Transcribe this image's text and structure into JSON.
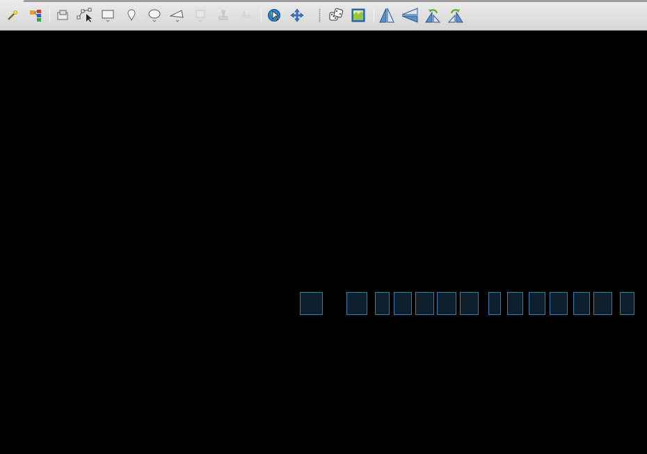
{
  "toolbar": {
    "buttons": [
      {
        "name": "magic-wand-tool-button",
        "icon": "magic-wand-icon",
        "enabled": true
      },
      {
        "name": "layers-tool-button",
        "icon": "color-layers-icon",
        "enabled": true
      },
      {
        "name": "select-region-button",
        "icon": "select-region-icon",
        "enabled": true
      },
      {
        "name": "draw-path-button",
        "icon": "path-arrow-icon",
        "enabled": true
      },
      {
        "name": "draw-rectangle-button",
        "icon": "rectangle-icon",
        "enabled": true
      },
      {
        "name": "draw-marker-button",
        "icon": "marker-pin-icon",
        "enabled": true
      },
      {
        "name": "draw-ellipse-button",
        "icon": "ellipse-icon",
        "enabled": true
      },
      {
        "name": "draw-polygon-button",
        "icon": "polygon-icon",
        "enabled": true
      },
      {
        "name": "image-tool-button",
        "icon": "image-icon",
        "enabled": false
      },
      {
        "name": "stamp-tool-button",
        "icon": "stamp-icon",
        "enabled": false
      },
      {
        "name": "text-tool-button",
        "icon": "text-icon",
        "enabled": false
      },
      {
        "name": "globe-navigate-button",
        "icon": "globe-cursor-icon",
        "enabled": true
      },
      {
        "name": "pan-button",
        "icon": "move-arrows-icon",
        "enabled": true
      },
      {
        "name": "random-button",
        "icon": "dice-icon",
        "enabled": true
      },
      {
        "name": "map-view-button",
        "icon": "map-view-icon",
        "enabled": true
      },
      {
        "name": "flip-horizontal-button",
        "icon": "flip-horizontal-icon",
        "enabled": true
      },
      {
        "name": "flip-vertical-button",
        "icon": "flip-vertical-icon",
        "enabled": true
      },
      {
        "name": "rotate-left-button",
        "icon": "rotate-left-icon",
        "enabled": true
      },
      {
        "name": "rotate-right-button",
        "icon": "rotate-right-icon",
        "enabled": true
      }
    ]
  },
  "canvas": {
    "background": "#000000",
    "cell_fill": "#0d1e2c",
    "cell_border": "#2e7fb3",
    "cell_count": 15
  }
}
